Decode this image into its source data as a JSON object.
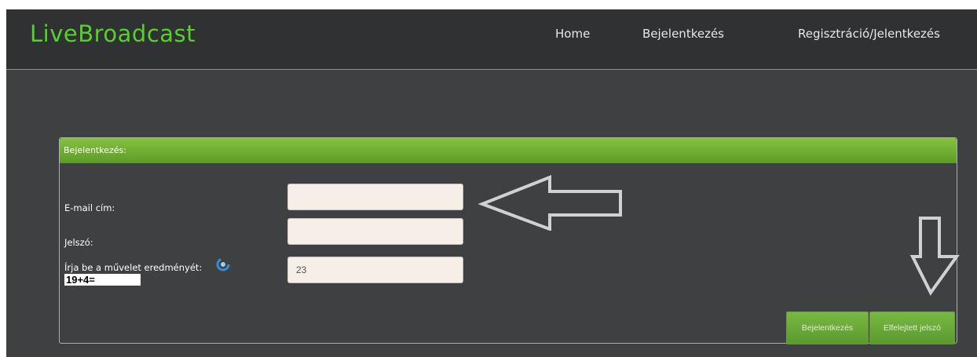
{
  "header": {
    "logo": "LiveBroadcast",
    "nav": [
      "Home",
      "Bejelentkezés",
      "Regisztráció/Jelentkezés"
    ]
  },
  "login": {
    "title": "Bejelentkezés:",
    "email_label": "E-mail cím:",
    "email_value": "",
    "password_label": "Jelszó:",
    "password_value": "",
    "captcha_label": "Írja be a művelet eredményét:",
    "captcha_question": "19+4=",
    "captcha_value": "23",
    "login_button": "Bejelentkezés",
    "forgot_button": "Elfelejtett jelszó"
  },
  "colors": {
    "background": "#3e4041",
    "accent": "#6aad33",
    "logo": "#55d12a"
  },
  "icons": [
    "refresh-icon",
    "left-arrow-annotation",
    "down-arrow-annotation"
  ]
}
